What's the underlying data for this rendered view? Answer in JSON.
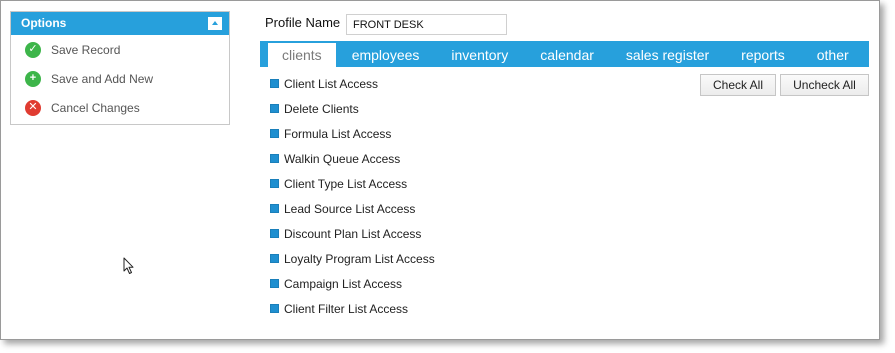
{
  "options": {
    "header": "Options",
    "items": [
      {
        "label": "Save Record",
        "icon": "checkmark-icon"
      },
      {
        "label": "Save and Add New",
        "icon": "plus-icon"
      },
      {
        "label": "Cancel Changes",
        "icon": "cancel-icon"
      }
    ]
  },
  "profile": {
    "label": "Profile Name",
    "value": "FRONT DESK"
  },
  "tabs": [
    {
      "label": "clients",
      "active": true
    },
    {
      "label": "employees"
    },
    {
      "label": "inventory"
    },
    {
      "label": "calendar"
    },
    {
      "label": "sales register"
    },
    {
      "label": "reports"
    },
    {
      "label": "other"
    }
  ],
  "buttons": {
    "check_all": "Check All",
    "uncheck_all": "Uncheck All"
  },
  "permissions": [
    {
      "label": "Client List Access",
      "checked": true
    },
    {
      "label": "Delete Clients",
      "checked": true
    },
    {
      "label": "Formula List Access",
      "checked": true
    },
    {
      "label": "Walkin Queue Access",
      "checked": true
    },
    {
      "label": "Client Type List Access",
      "checked": true
    },
    {
      "label": "Lead Source List Access",
      "checked": true
    },
    {
      "label": "Discount Plan List Access",
      "checked": true
    },
    {
      "label": "Loyalty Program List Access",
      "checked": true
    },
    {
      "label": "Campaign List Access",
      "checked": true
    },
    {
      "label": "Client Filter List Access",
      "checked": true
    }
  ],
  "colors": {
    "accent": "#27a0dc",
    "success": "#3db54a",
    "danger": "#e03c31"
  }
}
